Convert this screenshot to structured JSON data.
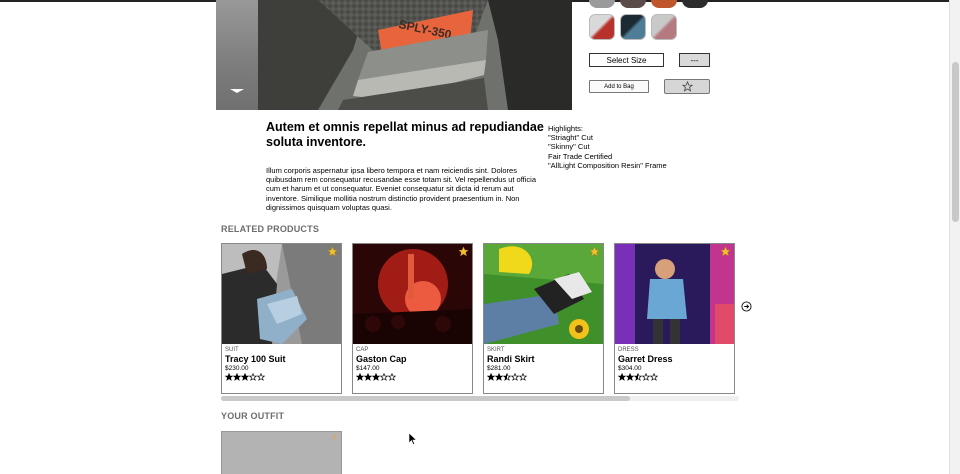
{
  "hero": {
    "shoe_text": "SPLY-350",
    "colors": {
      "accent": "#ff5b3b",
      "dark": "#2e2f2c"
    }
  },
  "styles": {
    "top_row_colors": [
      "#9a9a9a",
      "#5a4c48",
      "#c0562c",
      "#2c2c2c"
    ],
    "thumbs": [
      {
        "name": "red-white",
        "c1": "#d9d9d9",
        "c2": "#b8312a"
      },
      {
        "name": "blue-black",
        "c1": "#1c2a34",
        "c2": "#4f7d97"
      },
      {
        "name": "grey-pink",
        "c1": "#c9c9c9",
        "c2": "#b57a80"
      }
    ]
  },
  "controls": {
    "size_label": "Select Size",
    "qty_label": "---",
    "add_to_bag": "Add to Bag"
  },
  "product": {
    "slogan": "Autem et omnis repellat minus ad repudiandae soluta inventore.",
    "description": "Illum corporis aspernatur ipsa libero tempora et nam reiciendis sint. Dolores quibusdam rem consequatur recusandae esse totam sit. Vel repellendus ut officia cum et harum et ut consequatur. Eveniet consequatur sit dicta id rerum aut inventore. Similique mollitia nostrum distinctio provident praesentium in. Non dignissimos quisquam voluptas quasi.",
    "highlights_title": "Highlights:",
    "highlights": [
      "\"Striaght\" Cut",
      "\"Skinny\" Cut",
      "Fair Trade Certified",
      "\"AllLight Composition Resin\" Frame"
    ]
  },
  "related": {
    "title": "RELATED PRODUCTS",
    "items": [
      {
        "category": "SUIT",
        "name": "Tracy 100 Suit",
        "price": "$230.00",
        "rating": 3
      },
      {
        "category": "CAP",
        "name": "Gaston Cap",
        "price": "$147.00",
        "rating": 3
      },
      {
        "category": "SKIRT",
        "name": "Randi Skirt",
        "price": "$281.00",
        "rating": 2.5
      },
      {
        "category": "DRESS",
        "name": "Garret Dress",
        "price": "$304.00",
        "rating": 2.5
      }
    ],
    "scroll_fraction": 0.79
  },
  "outfit": {
    "title": "YOUR OUTFIT",
    "remove_glyph": "✕"
  },
  "icons": {
    "favorite": "star-outline-icon",
    "card_star": "star-filled-icon",
    "next": "circle-arrow-right-icon",
    "carousel_down": "chevron-down-icon"
  },
  "colors": {
    "star_gold": "#f2c12e",
    "section_gray": "#6d6d6d"
  }
}
